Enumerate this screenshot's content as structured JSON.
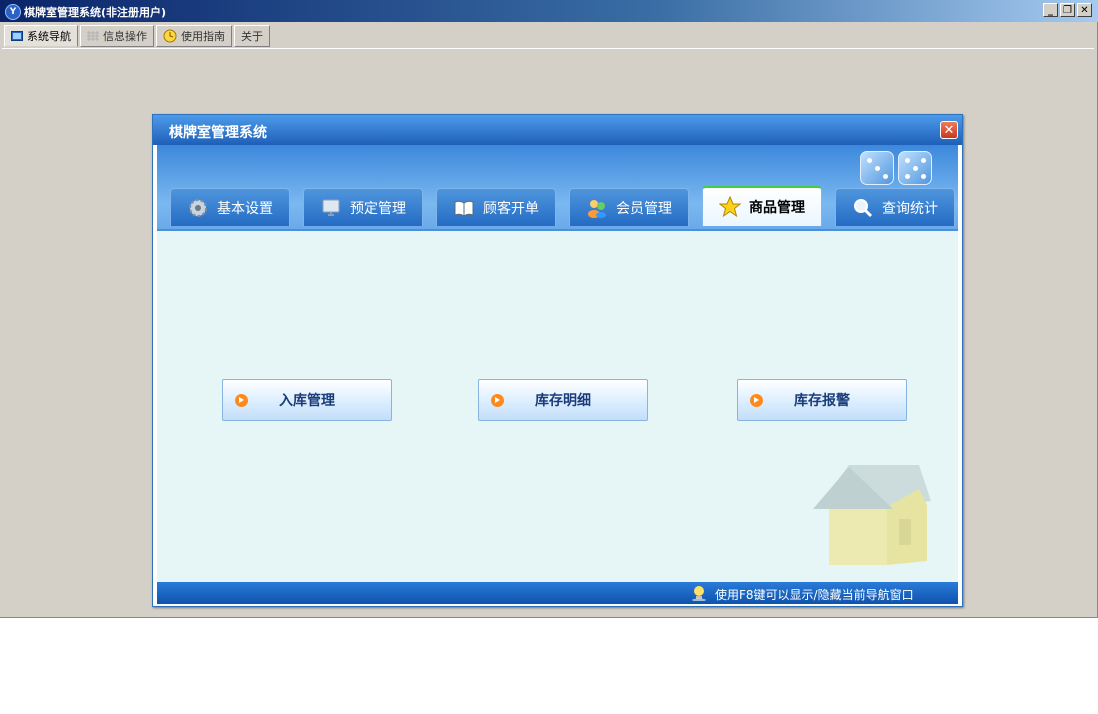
{
  "window": {
    "title": "棋牌室管理系统(非注册用户)",
    "controls": [
      "_",
      "❐",
      "✕"
    ]
  },
  "app_tabs": [
    {
      "label": "系统导航",
      "icon": "monitor-icon",
      "active": true
    },
    {
      "label": "信息操作",
      "icon": "grid-icon",
      "active": false
    },
    {
      "label": "使用指南",
      "icon": "clock-icon",
      "active": false
    },
    {
      "label": "关于",
      "icon": "",
      "active": false
    }
  ],
  "dialog": {
    "title": "棋牌室管理系统",
    "close_label": "✕",
    "tabs": [
      {
        "label": "基本设置",
        "icon": "gear-icon",
        "active": false
      },
      {
        "label": "预定管理",
        "icon": "monitor-icon",
        "active": false
      },
      {
        "label": "顾客开单",
        "icon": "book-icon",
        "active": false
      },
      {
        "label": "会员管理",
        "icon": "users-icon",
        "active": false
      },
      {
        "label": "商品管理",
        "icon": "star-icon",
        "active": true
      },
      {
        "label": "查询统计",
        "icon": "magnifier-icon",
        "active": false
      }
    ],
    "actions": [
      {
        "label": "入库管理",
        "icon": "arrow-right-circle-icon"
      },
      {
        "label": "库存明细",
        "icon": "arrow-right-circle-icon"
      },
      {
        "label": "库存报警",
        "icon": "arrow-right-circle-icon"
      }
    ],
    "status_text": "使用F8键可以显示/隐藏当前导航窗口",
    "status_icon": "lightbulb-icon"
  },
  "colors": {
    "accent_blue": "#1e5fb8",
    "content_bg": "#e6f6f6",
    "button_text": "#1b3c7a",
    "action_icon": "#ff8a1c",
    "active_tab_indicator": "#40d040"
  }
}
